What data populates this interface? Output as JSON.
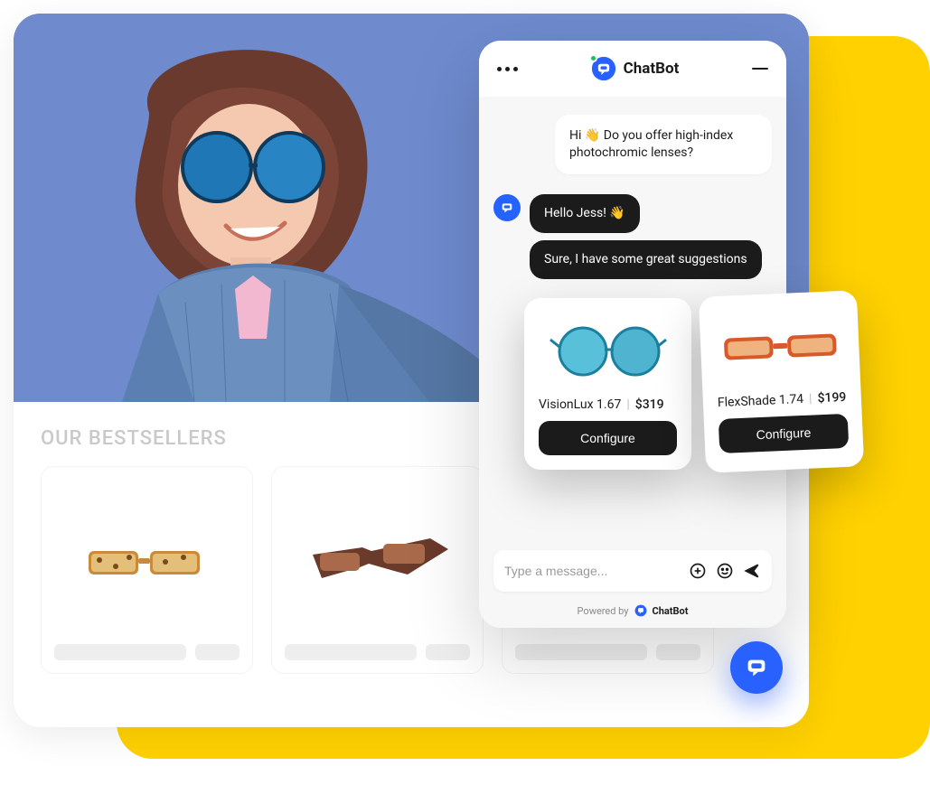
{
  "site": {
    "bestsellers_heading": "OUR BESTSELLERS"
  },
  "chat": {
    "title": "ChatBot",
    "user_msg": "Hi 👋 Do you offer high-index photochromic lenses?",
    "bot_msg_1": "Hello Jess! 👋",
    "bot_msg_2": "Sure, I have some great suggestions",
    "input_placeholder": "Type a message...",
    "powered_by": "Powered by",
    "powered_brand": "ChatBot"
  },
  "products": [
    {
      "name": "VisionLux 1.67",
      "price": "$319",
      "cta": "Configure"
    },
    {
      "name": "FlexShade 1.74",
      "price": "$199",
      "cta": "Configure"
    }
  ]
}
